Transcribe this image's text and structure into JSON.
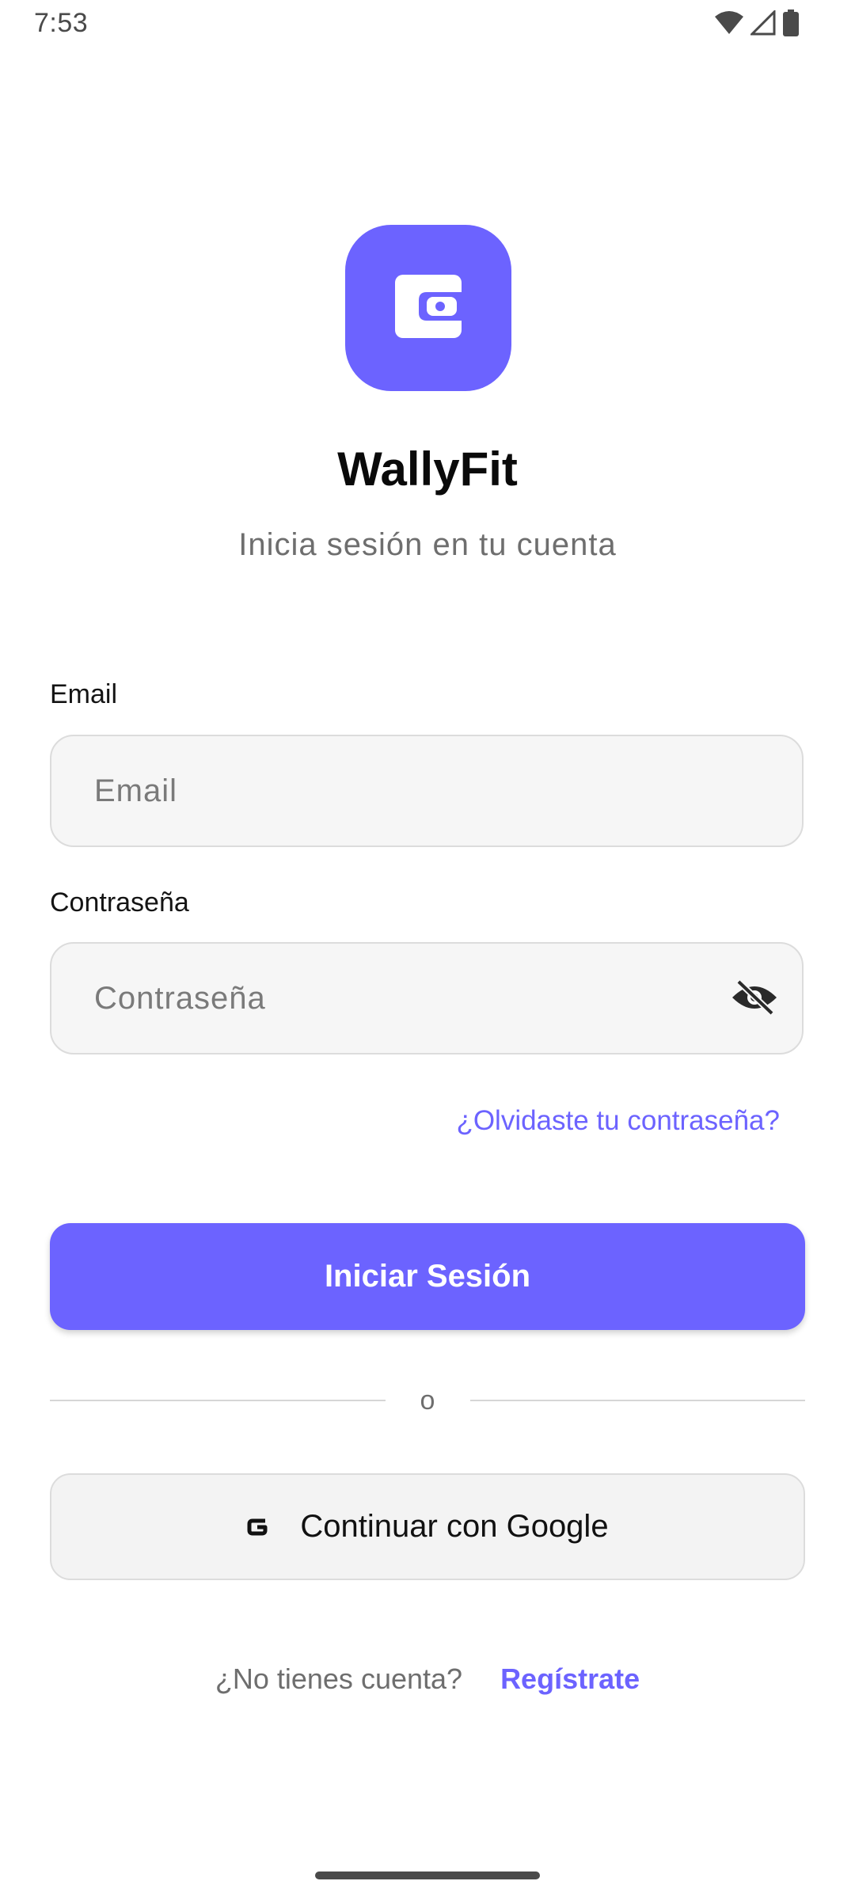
{
  "status_bar": {
    "time": "7:53",
    "icons": [
      "wifi-icon",
      "signal-icon",
      "battery-icon"
    ]
  },
  "branding": {
    "logo_icon": "wallet-icon",
    "app_name": "WallyFit",
    "subtitle": "Inicia sesión en tu cuenta"
  },
  "form": {
    "email_label": "Email",
    "email_placeholder": "Email",
    "email_value": "",
    "password_label": "Contraseña",
    "password_placeholder": "Contraseña",
    "password_value": "",
    "password_toggle_icon": "eye-off-icon",
    "forgot_password": "¿Olvidaste tu contraseña?",
    "submit_label": "Iniciar Sesión"
  },
  "divider": {
    "text": "o"
  },
  "social": {
    "google_icon": "google-icon",
    "google_label": "Continuar con Google"
  },
  "signup": {
    "prompt": "¿No tienes cuenta?",
    "link": "Regístrate"
  },
  "colors": {
    "accent": "#6c63ff",
    "background": "#ffffff",
    "field_background": "#f6f6f6",
    "text_primary": "#0a0a0a",
    "text_secondary": "#6e6e6e"
  }
}
